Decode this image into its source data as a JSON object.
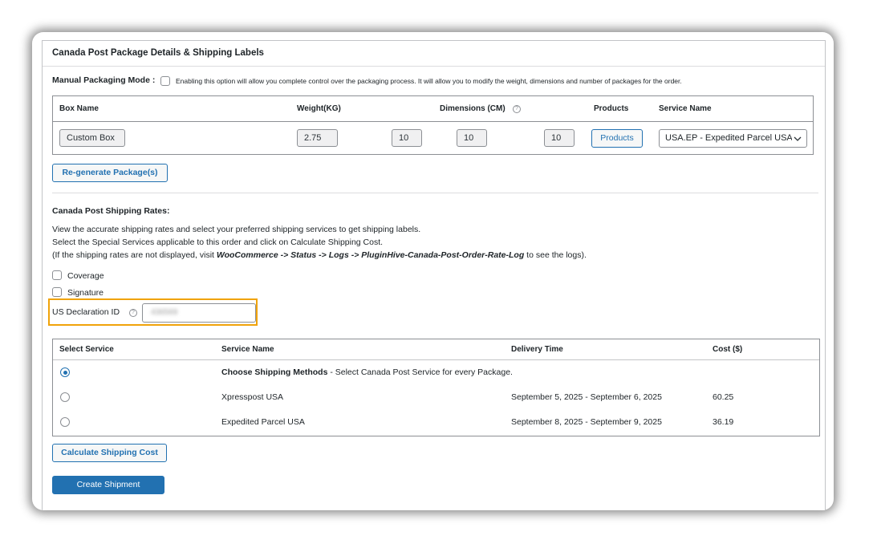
{
  "panel_title": "Canada Post Package Details & Shipping Labels",
  "manual_packaging": {
    "label": "Manual Packaging Mode :",
    "description": "Enabling this option will allow you complete control over the packaging process. It will allow you to modify the weight, dimensions and number of packages for the order."
  },
  "package_table": {
    "headers": {
      "box_name": "Box Name",
      "weight": "Weight(KG)",
      "dimensions": "Dimensions (CM)",
      "products": "Products",
      "service": "Service Name"
    },
    "row": {
      "box_name": "Custom Box",
      "weight": "2.75",
      "length": "10",
      "width": "10",
      "height": "10",
      "products_button": "Products",
      "service_selected": "USA.EP - Expedited Parcel USA"
    }
  },
  "regenerate_button": "Re-generate Package(s)",
  "rates": {
    "heading": "Canada Post Shipping Rates:",
    "line1": "View the accurate shipping rates and select your preferred shipping services to get shipping labels.",
    "line2": "Select the Special Services applicable to this order and click on Calculate Shipping Cost.",
    "line3_prefix": "(If the shipping rates are not displayed, visit ",
    "line3_path": "WooCommerce -> Status -> Logs -> PluginHive-Canada-Post-Order-Rate-Log",
    "line3_suffix": " to see the logs)."
  },
  "options": {
    "coverage": "Coverage",
    "signature": "Signature"
  },
  "us_declaration": {
    "label": "US Declaration ID",
    "value": "436569"
  },
  "services_table": {
    "headers": {
      "select": "Select Service",
      "name": "Service Name",
      "delivery": "Delivery Time",
      "cost": "Cost ($)"
    },
    "choose_row": {
      "name_bold": "Choose Shipping Methods",
      "name_rest": " - Select Canada Post Service for every Package."
    },
    "rows": [
      {
        "name": "Xpresspost USA",
        "delivery": "September 5, 2025 - September 6, 2025",
        "cost": "60.25"
      },
      {
        "name": "Expedited Parcel USA",
        "delivery": "September 8, 2025 - September 9, 2025",
        "cost": "36.19"
      }
    ]
  },
  "calculate_button": "Calculate Shipping Cost",
  "create_button": "Create Shipment",
  "colors": {
    "accent": "#2271b1",
    "highlight": "#f0a30a"
  }
}
